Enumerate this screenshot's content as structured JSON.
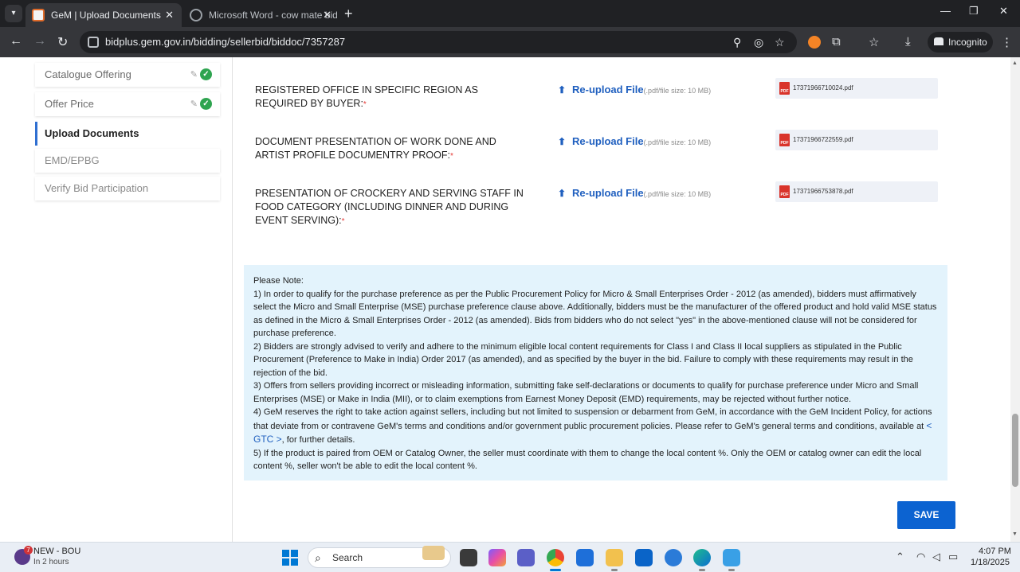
{
  "browser": {
    "tabs": [
      {
        "title": "GeM | Upload Documents",
        "active": true
      },
      {
        "title": "Microsoft Word - cow mate bid",
        "active": false
      }
    ],
    "url": "bidplus.gem.gov.in/bidding/sellerbid/biddoc/7357287",
    "incognito_label": "Incognito"
  },
  "sidebar": {
    "items": [
      {
        "label": "Catalogue Offering",
        "state": "complete"
      },
      {
        "label": "Offer Price",
        "state": "complete"
      },
      {
        "label": "Upload Documents",
        "state": "active"
      },
      {
        "label": "EMD/EPBG",
        "state": "pending"
      },
      {
        "label": "Verify Bid Participation",
        "state": "pending"
      }
    ]
  },
  "documents": [
    {
      "label": "REGISTERED OFFICE IN SPECIFIC REGION AS REQUIRED BY BUYER:",
      "required_mark": "*",
      "upload_label": "Re-upload File",
      "upload_hint": "(.pdf/file size: 10 MB)",
      "file_name": "17371966710024.pdf"
    },
    {
      "label": "DOCUMENT PRESENTATION OF WORK DONE AND ARTIST PROFILE DOCUMENTRY PROOF:",
      "required_mark": "*",
      "upload_label": "Re-upload File",
      "upload_hint": "(.pdf/file size: 10 MB)",
      "file_name": "17371966722559.pdf"
    },
    {
      "label": "PRESENTATION OF CROCKERY AND SERVING STAFF IN FOOD CATEGORY (INCLUDING DINNER AND DURING EVENT SERVING):",
      "required_mark": "*",
      "upload_label": "Re-upload File",
      "upload_hint": "(.pdf/file size: 10 MB)",
      "file_name": "17371966753878.pdf"
    }
  ],
  "note": {
    "heading": "Please Note:",
    "p1": "1) In order to qualify for the purchase preference as per the Public Procurement Policy for Micro & Small Enterprises Order - 2012 (as amended), bidders must affirmatively select the Micro and Small Enterprise (MSE) purchase preference clause above. Additionally, bidders must be the manufacturer of the offered product and hold valid MSE status as defined in the Micro & Small Enterprises Order - 2012 (as amended). Bids from bidders who do not select \"yes\" in the above-mentioned clause will not be considered for purchase preference.",
    "p2": "2) Bidders are strongly advised to verify and adhere to the minimum eligible local content requirements for Class I and Class II local suppliers as stipulated in the Public Procurement (Preference to Make in India) Order 2017 (as amended), and as specified by the buyer in the bid. Failure to comply with these requirements may result in the rejection of the bid.",
    "p3": "3) Offers from sellers providing incorrect or misleading information, submitting fake self-declarations or documents to qualify for purchase preference under Micro and Small Enterprises (MSE) or Make in India (MII), or to claim exemptions from Earnest Money Deposit (EMD) requirements, may be rejected without further notice.",
    "p4_before_link": "4) GeM reserves the right to take action against sellers, including but not limited to suspension or debarment from GeM, in accordance with the GeM Incident Policy, for actions that deviate from or contravene GeM's terms and conditions and/or government public procurement policies. Please refer to GeM's general terms and conditions, available at",
    "p4_link": "< GTC >",
    "p4_after_link": ", for further details.",
    "p5": "5) If the product is paired from OEM or Catalog Owner, the seller must coordinate with them to change the local content %. Only the OEM or catalog owner can edit the local content %, seller won't be able to edit the local content %."
  },
  "save_label": "SAVE",
  "taskbar": {
    "weather_badge": "7",
    "weather_title": "NEW - BOU",
    "weather_sub": "In 2 hours",
    "search_label": "Search",
    "time": "4:07 PM",
    "date": "1/18/2025"
  },
  "colors": {
    "primary_blue": "#0c63d1",
    "link_blue": "#1f5fbf",
    "note_bg": "#e3f3fc",
    "check_green": "#2ea44f",
    "required_red": "#e53935"
  }
}
